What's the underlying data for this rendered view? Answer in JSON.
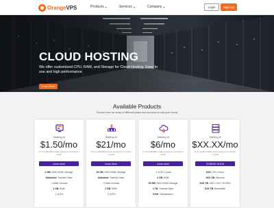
{
  "brand": {
    "name_orange": "Orange",
    "name_dark": "VPS"
  },
  "nav": {
    "items": [
      {
        "label": "Products"
      },
      {
        "label": "Services"
      },
      {
        "label": "Company"
      }
    ],
    "login_label": "Login",
    "signup_label": "Sign Up"
  },
  "hero": {
    "title": "CLOUD HOSTING",
    "subtitle": "We offer customized CPU, RAM, and Storage for Cloud Hosting. Easy to use and high performance",
    "button_label": "Learn More"
  },
  "products": {
    "title": "Available Products",
    "subtitle": "Choose from an array of different plans and services to suit your needs",
    "plans": [
      {
        "icon": "server-icon",
        "starting": "Starting at",
        "price": "$1.50/mo",
        "note": "Or for as $1.50/mo when paying for more than a month",
        "button": "Learn More",
        "features": [
          {
            "bold": "4 GB",
            "text": "SSD NVMe Storage"
          },
          {
            "bold": "Unlimited",
            "text": "Transfer Data"
          },
          {
            "bold": "",
            "text": "1 Main Domain"
          },
          {
            "bold": "1 GB",
            "text": "RAM"
          },
          {
            "bold": "",
            "text": "1 vCPU"
          }
        ]
      },
      {
        "icon": "network-icon",
        "starting": "Starting at",
        "price": "$21/mo",
        "note": "Or for as $16.80/mo when paying for more than a month",
        "button": "Learn More",
        "features": [
          {
            "bold": "30 GB",
            "text": "SSD NVMe Storage"
          },
          {
            "bold": "Unlimited",
            "text": "Transfer Data"
          },
          {
            "bold": "",
            "text": "5 Main Domain"
          },
          {
            "bold": "2 GB",
            "text": "RAM"
          },
          {
            "bold": "",
            "text": "2 vCPU"
          }
        ]
      },
      {
        "icon": "cloud-icon",
        "starting": "Starting at",
        "price": "$6/mo",
        "note": "Or for as $4.80/mo when paying for more than a month",
        "button": "Learn More",
        "features": [
          {
            "bold": "",
            "text": "1 vCPU Cores"
          },
          {
            "bold": "2 GB",
            "text": "RAM"
          },
          {
            "bold": "25 GB",
            "text": "SSD NVMe Storage"
          },
          {
            "bold": "1 TB",
            "text": "Transfer Data"
          },
          {
            "bold": "KVM",
            "text": "Virtualization"
          }
        ]
      },
      {
        "icon": "dedicated-server-icon",
        "starting": "Starting at",
        "price": "$XX.XX/mo",
        "note": "Or for as $XX.XX/mo when paying for more than a month",
        "button": "COMING SOON",
        "features": [
          {
            "bold": "XXX",
            "text": "CPU Cores"
          },
          {
            "bold": "XXX GB",
            "text": "Memory"
          },
          {
            "bold": "XXX TB",
            "text": "SSD / XXX TB HDD"
          },
          {
            "bold": "XXX TB",
            "text": "Bandwidth"
          }
        ]
      }
    ]
  },
  "colors": {
    "accent": "#f26b21",
    "primary_button": "#4a1fa8"
  }
}
